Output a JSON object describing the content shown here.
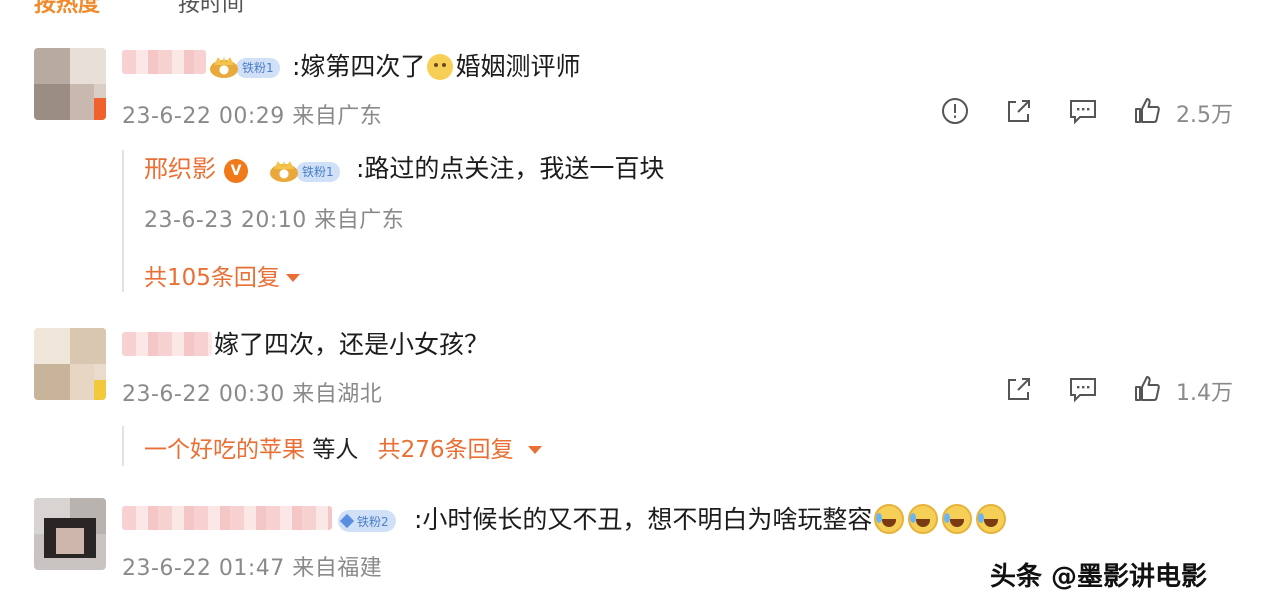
{
  "top_tabs": {
    "hot_label": "按热度",
    "time_label": "按时间"
  },
  "comments": [
    {
      "text": ":嫁第四次了",
      "text_tail": "婚姻测评师",
      "fan_badge": "铁粉1",
      "timestamp": "23-6-22 00:29",
      "location": "来自广东",
      "like_count": "2.5万",
      "reply": {
        "name": "邢织影",
        "fan_badge": "铁粉1",
        "text": ":路过的点关注，我送一百块",
        "timestamp": "23-6-23 20:10",
        "location": "来自广东",
        "reply_count_label": "共105条回复"
      }
    },
    {
      "text": "嫁了四次，还是小女孩？",
      "timestamp": "23-6-22 00:30",
      "location": "来自湖北",
      "like_count": "1.4万",
      "reply_names": {
        "first": "一个好吃的苹果",
        "rest": "等人"
      },
      "reply_count_label": "共276条回复"
    },
    {
      "fan_badge": "铁粉2",
      "text": ":小时候长的又不丑，想不明白为啥玩整容",
      "timestamp": "23-6-22 01:47",
      "location": "来自福建"
    }
  ],
  "watermark": "头条 @墨影讲电影",
  "colors": {
    "accent": "#ea6f34",
    "meta": "#8a8a8a",
    "badge_bg": "#cfe0f7",
    "badge_text": "#4d7fc8"
  },
  "icons": [
    "report-icon",
    "share-icon",
    "comment-icon",
    "like-icon"
  ]
}
